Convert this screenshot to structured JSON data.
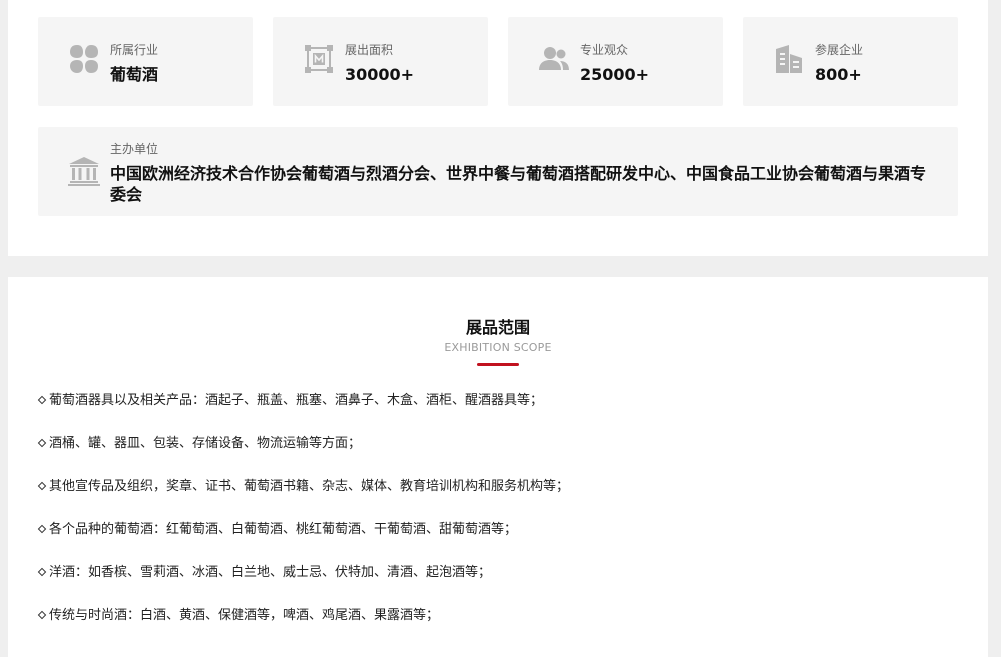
{
  "stats": [
    {
      "label": "所属行业",
      "value": "葡萄酒",
      "icon": "category-grid-icon"
    },
    {
      "label": "展出面积",
      "value": "30000+",
      "icon": "area-frame-icon"
    },
    {
      "label": "专业观众",
      "value": "25000+",
      "icon": "audience-people-icon"
    },
    {
      "label": "参展企业",
      "value": "800+",
      "icon": "company-building-icon"
    }
  ],
  "organizer": {
    "label": "主办单位",
    "value": "中国欧洲经济技术合作协会葡萄酒与烈酒分会、世界中餐与葡萄酒搭配研发中心、中国食品工业协会葡萄酒与果酒专委会",
    "icon": "institution-icon"
  },
  "scope": {
    "title": "展品范围",
    "subtitle": "EXHIBITION SCOPE",
    "accent_color": "#c1121f",
    "items": [
      "葡萄酒器具以及相关产品：酒起子、瓶盖、瓶塞、酒鼻子、木盒、酒柜、醒酒器具等；",
      "酒桶、罐、器皿、包装、存储设备、物流运输等方面；",
      "其他宣传品及组织，奖章、证书、葡萄酒书籍、杂志、媒体、教育培训机构和服务机构等；",
      "各个品种的葡萄酒：红葡萄酒、白葡萄酒、桃红葡萄酒、干葡萄酒、甜葡萄酒等；",
      "洋酒：如香槟、雪莉酒、冰酒、白兰地、威士忌、伏特加、清酒、起泡酒等；",
      "传统与时尚酒：白酒、黄酒、保健酒等，啤酒、鸡尾酒、果露酒等；"
    ]
  },
  "colors": {
    "card_background": "#f5f5f5",
    "icon_gray": "#b5b5b5",
    "page_background": "#efefef"
  }
}
